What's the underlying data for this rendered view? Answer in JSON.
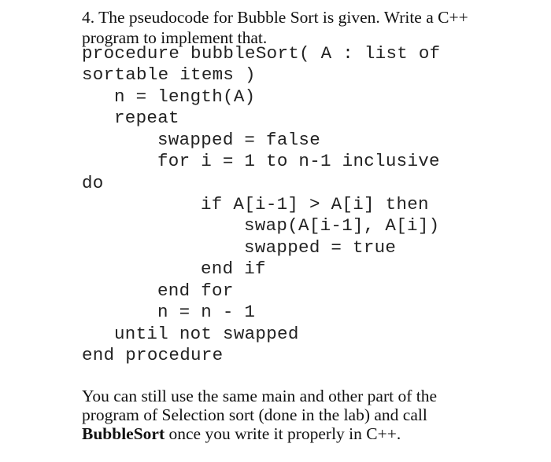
{
  "question": {
    "number_and_title_line1": "4. The pseudocode for Bubble Sort is given. Write a C++",
    "title_line2": "program to implement that."
  },
  "pseudocode": {
    "lines": [
      {
        "indent": "",
        "text": "procedure bubbleSort( A : list of"
      },
      {
        "indent": "",
        "text": "sortable items )"
      },
      {
        "indent": "   ",
        "text": "n = length(A)"
      },
      {
        "indent": "   ",
        "text": "repeat"
      },
      {
        "indent": "       ",
        "text": "swapped = false"
      },
      {
        "indent": "       ",
        "text": "for i = 1 to n-1 inclusive"
      },
      {
        "indent": "",
        "text": "do"
      },
      {
        "indent": "           ",
        "text": "if A[i-1] > A[i] then"
      },
      {
        "indent": "               ",
        "text": "swap(A[i-1], A[i])"
      },
      {
        "indent": "               ",
        "text": "swapped = true"
      },
      {
        "indent": "           ",
        "text": "end if"
      },
      {
        "indent": "       ",
        "text": "end for"
      },
      {
        "indent": "       ",
        "text": "n = n - 1"
      },
      {
        "indent": "   ",
        "text": "until not swapped"
      },
      {
        "indent": "",
        "text": "end procedure"
      }
    ]
  },
  "note": {
    "line1": "You can still use the same main and other part of the",
    "line2": "program of Selection sort (done in the lab) and call",
    "line3_bold": "BubbleSort",
    "line3_rest": " once you write it properly in C++."
  }
}
